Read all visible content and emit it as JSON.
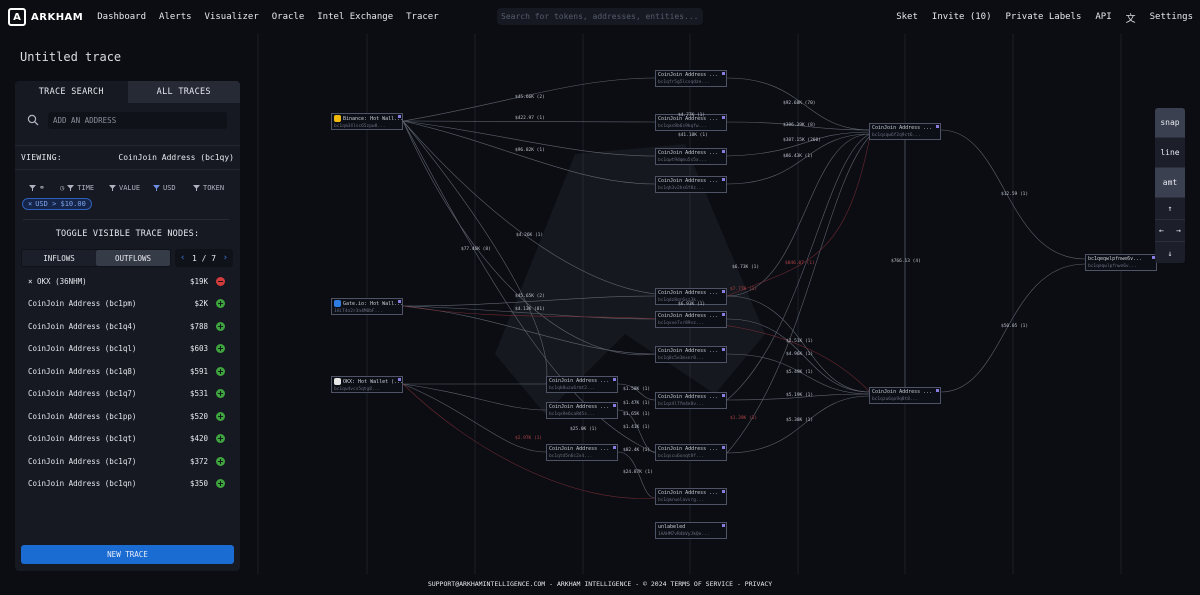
{
  "brand": {
    "name": "ARKHAM"
  },
  "nav": {
    "links": [
      "Dashboard",
      "Alerts",
      "Visualizer",
      "Oracle",
      "Intel Exchange",
      "Tracer"
    ],
    "search_placeholder": "Search for tokens, addresses, entities...",
    "right": [
      "Sket",
      "Invite (10)",
      "Private Labels",
      "API"
    ],
    "settings": "Settings",
    "translate_icon": "translate-icon"
  },
  "page": {
    "title": "Untitled trace"
  },
  "panel": {
    "tabs": [
      "TRACE SEARCH",
      "ALL TRACES"
    ],
    "active_tab": "TRACE SEARCH",
    "address_placeholder": "ADD AN ADDRESS",
    "viewing_label": "VIEWING:",
    "viewing_value": "CoinJoin Address (bc1qy)",
    "filters": {
      "time": "TIME",
      "value": "VALUE",
      "usd": "USD",
      "token": "TOKEN"
    },
    "chip": "USD > $10.00",
    "toggle_title": "TOGGLE VISIBLE TRACE NODES:",
    "segments": {
      "inflows": "INFLOWS",
      "outflows": "OUTFLOWS"
    },
    "selected_segment": "OUTFLOWS",
    "page_indicator": "1 / 7",
    "nodes": [
      {
        "name": "OKX (36NHM)",
        "value": "$19K",
        "action": "remove",
        "prefix": "×"
      },
      {
        "name": "CoinJoin Address (bc1pm)",
        "value": "$2K",
        "action": "add"
      },
      {
        "name": "CoinJoin Address (bc1q4)",
        "value": "$788",
        "action": "add"
      },
      {
        "name": "CoinJoin Address (bc1ql)",
        "value": "$603",
        "action": "add"
      },
      {
        "name": "CoinJoin Address (bc1q8)",
        "value": "$591",
        "action": "add"
      },
      {
        "name": "CoinJoin Address (bc1q7)",
        "value": "$531",
        "action": "add"
      },
      {
        "name": "CoinJoin Address (bc1pp)",
        "value": "$520",
        "action": "add"
      },
      {
        "name": "CoinJoin Address (bc1qt)",
        "value": "$420",
        "action": "add"
      },
      {
        "name": "CoinJoin Address (bc1q7)",
        "value": "$372",
        "action": "add"
      },
      {
        "name": "CoinJoin Address (bc1qn)",
        "value": "$350",
        "action": "add"
      }
    ],
    "new_trace": "NEW TRACE"
  },
  "graph": {
    "nodes": [
      {
        "id": "binance",
        "title": "Binance: Hot Wall...",
        "sub": "bc1qm34lsc65zpw8..."
      },
      {
        "id": "gate",
        "title": "Gate.io: Hot Wall...",
        "sub": "1HiT4n2r3n4M8bF..."
      },
      {
        "id": "okx",
        "title": "OKX: Hot Wallet (...",
        "sub": "bc1qu4vcs5qtg8..."
      },
      {
        "id": "c1",
        "title": "CoinJoin Address ...",
        "sub": "bc1qfr5g5lcsqdze..."
      },
      {
        "id": "c2",
        "title": "CoinJoin Address ...",
        "sub": "bc1qas8b6s9kqfw..."
      },
      {
        "id": "c3",
        "title": "CoinJoin Address ...",
        "sub": "bc1qwt9dqmu5s5x..."
      },
      {
        "id": "c4",
        "title": "CoinJoin Address ...",
        "sub": "bc1qh3v2hs6f8z..."
      },
      {
        "id": "c5",
        "title": "CoinJoin Address ...",
        "sub": "bc1qdz8qr6sz3k..."
      },
      {
        "id": "c6",
        "title": "CoinJoin Address ...",
        "sub": "bc1qvxe7vr89vz..."
      },
      {
        "id": "c7",
        "title": "CoinJoin Address ...",
        "sub": "bc1q8c5e3mxnr0..."
      },
      {
        "id": "c8",
        "title": "CoinJoin Address ...",
        "sub": "bc1qz4l7fm4n8v..."
      },
      {
        "id": "c9",
        "title": "CoinJoin Address ...",
        "sub": "bc1qscu6xnqt8f..."
      },
      {
        "id": "c10",
        "title": "CoinJoin Address ...",
        "sub": "bc1qk8uzu6rmt2..."
      },
      {
        "id": "c11",
        "title": "CoinJoin Address ...",
        "sub": "bc1qx9e6ca8d5s..."
      },
      {
        "id": "c12",
        "title": "CoinJoin Address ...",
        "sub": "bc1qtd5n6c2v4..."
      },
      {
        "id": "c13",
        "title": "CoinJoin Address ...",
        "sub": "bc1qmrwelavsrg..."
      },
      {
        "id": "unl",
        "title": "unlabeled",
        "sub": "1AAHM7vR4bVyJkQe..."
      },
      {
        "id": "c14",
        "title": "CoinJoin Address ...",
        "sub": "bc1qsqw6f2q9ct6..."
      },
      {
        "id": "c15",
        "title": "CoinJoin Address ...",
        "sub": "bc1qzu6qx9q8t8..."
      },
      {
        "id": "bp",
        "title": "bc1qeqwlpfnwe6v...",
        "sub": "bc1qeqwlpfnwe6v..."
      }
    ],
    "edge_labels": [
      "$45.66K (2)",
      "$422.97 (1)",
      "$4.77K (1)",
      "$96.82K (1)",
      "$92.68K (70)",
      "$386.39K (8)",
      "$41.18K (1)",
      "$387.15K (260)",
      "$86.43K (1)",
      "$77.46K (8)",
      "$4.26K (1)",
      "$6.73K (1)",
      "$846.07 (1)",
      "$7.77K (1)",
      "$45.65K (2)",
      "$4.13K (81)",
      "$6.93K (1)",
      "$2.51K (1)",
      "$4.96K (1)",
      "$5.49K (1)",
      "$5.19K (1)",
      "$5.38K (1)",
      "$1.58K (1)",
      "$1.47K (1)",
      "$25.0K (1)",
      "$1.41K (1)",
      "$1.65K (1)",
      "$82.4K (1)",
      "$24.87K (1)",
      "$2.97K (1)",
      "$12.59 (1)",
      "$766.13 (4)",
      "$50.05 (1)",
      "$1.39K (1)"
    ]
  },
  "toolbar": {
    "snap": "snap",
    "line": "line",
    "amt": "amt",
    "up": "↑",
    "left": "←",
    "right": "→",
    "down": "↓",
    "active": "amt"
  },
  "footer": "SUPPORT@ARKHAMINTELLIGENCE.COM - ARKHAM INTELLIGENCE - © 2024  TERMS OF SERVICE - PRIVACY"
}
